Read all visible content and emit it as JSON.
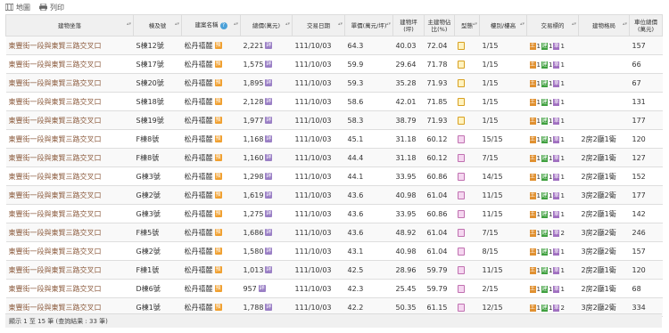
{
  "toolbar": {
    "map_label": "地圖",
    "print_label": "列印"
  },
  "headers": [
    "建物坐落",
    "棟及號",
    "建案名稱",
    "總價(萬元)",
    "交易日期",
    "單價(萬元/坪)",
    "建物坪(坪)",
    "主建物佔比(%)",
    "型態",
    "樓別/樓高",
    "交易標的",
    "建物格局",
    "車位總價(萬元)"
  ],
  "rows": [
    {
      "addr": "東豐街一段與東賢三路交叉口",
      "unit": "S棟12號",
      "project": "松丹禧麓",
      "total": "2,221",
      "date": "111/10/03",
      "price": "64.3",
      "area": "40.03",
      "ratio": "72.04",
      "type": "s",
      "floor": "1/15",
      "o1": "1",
      "o2": "1",
      "o3": "1",
      "layout": "",
      "parking": "157"
    },
    {
      "addr": "東豐街一段與東賢三路交叉口",
      "unit": "S棟17號",
      "project": "松丹禧麓",
      "total": "1,575",
      "date": "111/10/03",
      "price": "59.9",
      "area": "29.64",
      "ratio": "71.78",
      "type": "s",
      "floor": "1/15",
      "o1": "1",
      "o2": "1",
      "o3": "1",
      "layout": "",
      "parking": "66"
    },
    {
      "addr": "東豐街一段與東賢三路交叉口",
      "unit": "S棟20號",
      "project": "松丹禧麓",
      "total": "1,895",
      "date": "111/10/03",
      "price": "59.3",
      "area": "35.28",
      "ratio": "71.93",
      "type": "s",
      "floor": "1/15",
      "o1": "1",
      "o2": "1",
      "o3": "1",
      "layout": "",
      "parking": "67"
    },
    {
      "addr": "東豐街一段與東賢三路交叉口",
      "unit": "S棟18號",
      "project": "松丹禧麓",
      "total": "2,128",
      "date": "111/10/03",
      "price": "58.6",
      "area": "42.01",
      "ratio": "71.85",
      "type": "s",
      "floor": "1/15",
      "o1": "1",
      "o2": "1",
      "o3": "1",
      "layout": "",
      "parking": "131"
    },
    {
      "addr": "東豐街一段與東賢三路交叉口",
      "unit": "S棟19號",
      "project": "松丹禧麓",
      "total": "1,977",
      "date": "111/10/03",
      "price": "58.3",
      "area": "38.79",
      "ratio": "71.93",
      "type": "s",
      "floor": "1/15",
      "o1": "1",
      "o2": "1",
      "o3": "1",
      "layout": "",
      "parking": "177"
    },
    {
      "addr": "東豐街一段與東賢三路交叉口",
      "unit": "F棟8號",
      "project": "松丹禧麓",
      "total": "1,168",
      "date": "111/10/03",
      "price": "45.1",
      "area": "31.18",
      "ratio": "60.12",
      "type": "g",
      "floor": "15/15",
      "o1": "1",
      "o2": "1",
      "o3": "1",
      "layout": "2房2廳1衛",
      "parking": "120"
    },
    {
      "addr": "東豐街一段與東賢三路交叉口",
      "unit": "F棟8號",
      "project": "松丹禧麓",
      "total": "1,160",
      "date": "111/10/03",
      "price": "44.4",
      "area": "31.18",
      "ratio": "60.12",
      "type": "g",
      "floor": "7/15",
      "o1": "1",
      "o2": "1",
      "o3": "1",
      "layout": "2房2廳1衛",
      "parking": "127"
    },
    {
      "addr": "東豐街一段與東賢三路交叉口",
      "unit": "G棟3號",
      "project": "松丹禧麓",
      "total": "1,298",
      "date": "111/10/03",
      "price": "44.1",
      "area": "33.95",
      "ratio": "60.86",
      "type": "g",
      "floor": "14/15",
      "o1": "1",
      "o2": "1",
      "o3": "1",
      "layout": "2房2廳1衛",
      "parking": "152"
    },
    {
      "addr": "東豐街一段與東賢三路交叉口",
      "unit": "G棟2號",
      "project": "松丹禧麓",
      "total": "1,619",
      "date": "111/10/03",
      "price": "43.6",
      "area": "40.98",
      "ratio": "61.04",
      "type": "g",
      "floor": "11/15",
      "o1": "1",
      "o2": "1",
      "o3": "1",
      "layout": "3房2廳2衛",
      "parking": "177"
    },
    {
      "addr": "東豐街一段與東賢三路交叉口",
      "unit": "G棟3號",
      "project": "松丹禧麓",
      "total": "1,275",
      "date": "111/10/03",
      "price": "43.6",
      "area": "33.95",
      "ratio": "60.86",
      "type": "g",
      "floor": "11/15",
      "o1": "1",
      "o2": "1",
      "o3": "1",
      "layout": "2房2廳1衛",
      "parking": "142"
    },
    {
      "addr": "東豐街一段與東賢三路交叉口",
      "unit": "F棟5號",
      "project": "松丹禧麓",
      "total": "1,686",
      "date": "111/10/03",
      "price": "43.6",
      "area": "48.92",
      "ratio": "61.04",
      "type": "g",
      "floor": "7/15",
      "o1": "1",
      "o2": "1",
      "o3": "2",
      "layout": "3房2廳2衛",
      "parking": "246"
    },
    {
      "addr": "東豐街一段與東賢三路交叉口",
      "unit": "G棟2號",
      "project": "松丹禧麓",
      "total": "1,580",
      "date": "111/10/03",
      "price": "43.1",
      "area": "40.98",
      "ratio": "61.04",
      "type": "g",
      "floor": "8/15",
      "o1": "1",
      "o2": "1",
      "o3": "1",
      "layout": "3房2廳2衛",
      "parking": "157"
    },
    {
      "addr": "東豐街一段與東賢三路交叉口",
      "unit": "F棟1號",
      "project": "松丹禧麓",
      "total": "1,013",
      "date": "111/10/03",
      "price": "42.5",
      "area": "28.96",
      "ratio": "59.79",
      "type": "g",
      "floor": "11/15",
      "o1": "1",
      "o2": "1",
      "o3": "1",
      "layout": "2房2廳1衛",
      "parking": "120"
    },
    {
      "addr": "東豐街一段與東賢三路交叉口",
      "unit": "D棟6號",
      "project": "松丹禧麓",
      "total": "957",
      "date": "111/10/03",
      "price": "42.3",
      "area": "25.45",
      "ratio": "59.79",
      "type": "g",
      "floor": "2/15",
      "o1": "1",
      "o2": "1",
      "o3": "1",
      "layout": "2房2廳1衛",
      "parking": "68"
    },
    {
      "addr": "東豐街一段與東賢三路交叉口",
      "unit": "G棟1號",
      "project": "松丹禧麓",
      "total": "1,788",
      "date": "111/10/03",
      "price": "42.2",
      "area": "50.35",
      "ratio": "61.15",
      "type": "g",
      "floor": "12/15",
      "o1": "1",
      "o2": "1",
      "o3": "2",
      "layout": "3房2廳2衛",
      "parking": "334"
    }
  ],
  "footer": {
    "text": "顯示 1 至 15 筆 (查詢結果 : 33 筆)"
  },
  "colors": {
    "addr_link": "#8b5a3c",
    "header_bg": "#f0f0f0",
    "sale_badge": "#f0a030",
    "price_badge": "#9a7fc5"
  }
}
